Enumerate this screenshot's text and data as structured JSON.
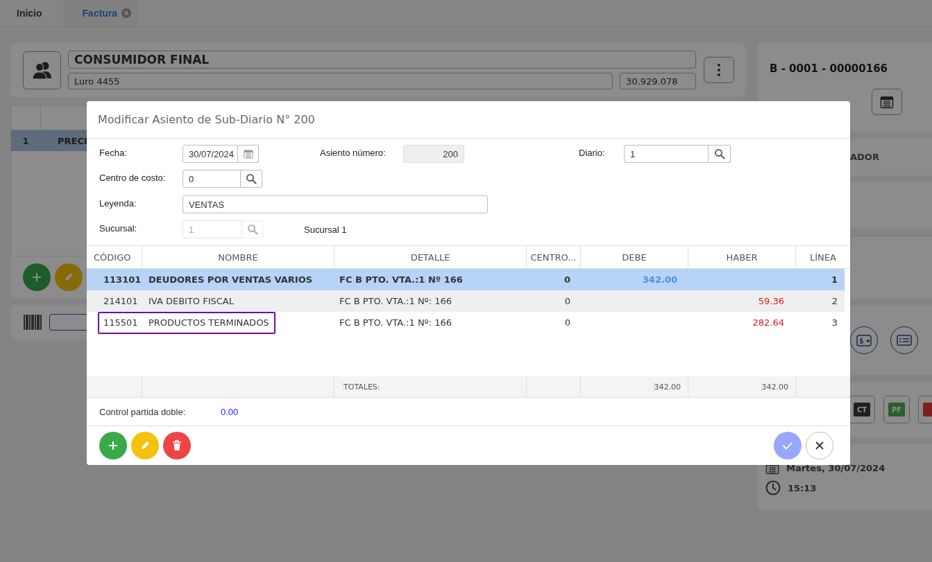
{
  "tabs": [
    {
      "label": "Inicio",
      "selected": false,
      "closable": false
    },
    {
      "label": "Factura",
      "selected": true,
      "closable": true
    }
  ],
  "customer": {
    "name": "CONSUMIDOR FINAL",
    "address": "Luro 4455",
    "tax_id": "30.929.078"
  },
  "items_grid": {
    "rows": [
      {
        "number": "1",
        "description": "PRECI",
        "selected": true
      }
    ]
  },
  "invoice_panel": {
    "number": "B - 0001 - 00000166",
    "section_label": "ADOR",
    "doc_buttons": [
      {
        "label": "CT",
        "kind": "dark"
      },
      {
        "label": "PF",
        "kind": "green"
      },
      {
        "kind": "red"
      }
    ],
    "date": "Martes, 30/07/2024",
    "time": "15:13"
  },
  "modal": {
    "title": "Modificar Asiento de Sub-Diario N° 200",
    "fecha": {
      "label": "Fecha:",
      "value": "30/07/2024"
    },
    "asiento": {
      "label": "Asiento número:",
      "value": "200"
    },
    "diario": {
      "label": "Diario:",
      "value": "1"
    },
    "centro": {
      "label": "Centro de costo:",
      "value": "0"
    },
    "leyenda": {
      "label": "Leyenda:",
      "value": "VENTAS"
    },
    "sucursal": {
      "label": "Sucursal:",
      "value": "1",
      "disabled": true,
      "name": "Sucursal 1"
    },
    "table": {
      "columns": [
        "CÓDIGO",
        "NOMBRE",
        "DETALLE",
        "CENTRO...",
        "DEBE",
        "HABER",
        "LÍNEA"
      ],
      "rows": [
        {
          "codigo": "113101",
          "nombre": "DEUDORES POR VENTAS VARIOS",
          "detalle": "FC B PTO. VTA.:1 Nº 166",
          "centro": "0",
          "debe": "342.00",
          "linea": "1",
          "selected": true,
          "outlined": false
        },
        {
          "codigo": "214101",
          "nombre": "IVA DEBITO FISCAL",
          "detalle": "FC B PTO. VTA.:1 Nº: 166",
          "centro": "0",
          "haber": "59.36",
          "linea": "2",
          "selected": false,
          "outlined": false
        },
        {
          "codigo": "115501",
          "nombre": "PRODUCTOS TERMINADOS",
          "detalle": "FC B PTO. VTA.:1 Nº: 166",
          "centro": "0",
          "haber": "282.64",
          "linea": "3",
          "selected": false,
          "outlined": true
        }
      ],
      "totals": {
        "label": "TOTALES:",
        "debe": "342.00",
        "haber": "342.00"
      }
    },
    "control": {
      "label": "Control partida doble:",
      "value": "0.00"
    }
  }
}
